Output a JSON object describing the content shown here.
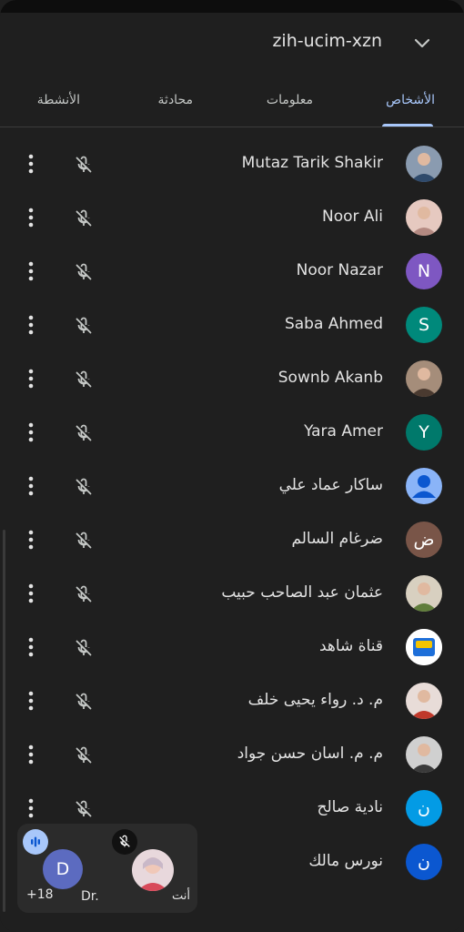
{
  "header": {
    "meeting_code": "zih-ucim-xzn",
    "collapse_icon": "chevron-down-icon"
  },
  "tabs": [
    {
      "label": "الأشخاص",
      "active": true
    },
    {
      "label": "معلومات",
      "active": false
    },
    {
      "label": "محادثة",
      "active": false
    },
    {
      "label": "الأنشطة",
      "active": false
    }
  ],
  "participants": [
    {
      "name": "Mutaz Tarik Shakir",
      "avatar": "photo",
      "avatar_colors": [
        "#8a9bb0",
        "#2f4a6b"
      ]
    },
    {
      "name": "Noor Ali",
      "avatar": "photo",
      "avatar_colors": [
        "#e6c9c0",
        "#b48a82"
      ]
    },
    {
      "name": "Noor Nazar",
      "avatar": "N",
      "color": "#7e57c2"
    },
    {
      "name": "Saba Ahmed",
      "avatar": "S",
      "color": "#00897b"
    },
    {
      "name": "Sownb Akanb",
      "avatar": "photo",
      "avatar_colors": [
        "#a58d7a",
        "#4a3a30"
      ]
    },
    {
      "name": "Yara Amer",
      "avatar": "Y",
      "color": "#00796b"
    },
    {
      "name": "ساكار عماد علي",
      "avatar": "person",
      "color": "#8ab4f8"
    },
    {
      "name": "ضرغام السالم",
      "avatar": "ض",
      "color": "#795548"
    },
    {
      "name": "عثمان عبد الصاحب حبيب",
      "avatar": "photo",
      "avatar_colors": [
        "#d8d0c0",
        "#607d3b"
      ]
    },
    {
      "name": "قناة شاهد",
      "avatar": "logo",
      "avatar_colors": [
        "#ffffff",
        "#1e6fd9"
      ]
    },
    {
      "name": "م. د. رواء يحيى خلف",
      "avatar": "photo",
      "avatar_colors": [
        "#e8dcd8",
        "#c0392b"
      ]
    },
    {
      "name": "م. م. اسان حسن جواد",
      "avatar": "photo",
      "avatar_colors": [
        "#d0d0d0",
        "#3a3a3a"
      ]
    },
    {
      "name": "نادية صالح",
      "avatar": "ن",
      "color": "#039be5"
    },
    {
      "name": "نورس مالك",
      "avatar": "ن",
      "color": "#0b57d0"
    }
  ],
  "row_icons": {
    "mic": "mic-off-icon",
    "more": "more-vert-icon"
  },
  "pip": {
    "speaker_initial": "D",
    "speaker_name": "Dr.",
    "others_count": "+18",
    "self_label": "أنت",
    "audio_icon": "audio-level-icon",
    "mute_icon": "mic-off-icon"
  },
  "colors": {
    "background": "#1f1f1f",
    "accent": "#a8c7fa",
    "text": "#e3e3e3"
  }
}
